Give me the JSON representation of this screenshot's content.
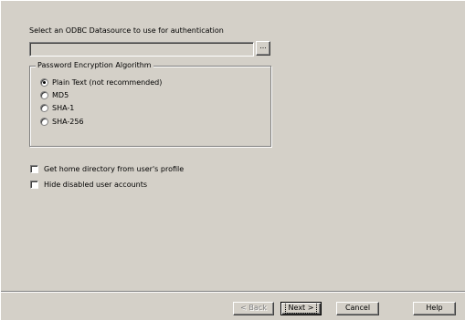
{
  "prompt": "Select an ODBC Datasource to use for authentication",
  "datasource": {
    "value": "",
    "browse_label": "..."
  },
  "encryption": {
    "title": "Password Encryption Algorithm",
    "options": [
      {
        "label": "Plain Text (not recommended)",
        "selected": true
      },
      {
        "label": "MD5",
        "selected": false
      },
      {
        "label": "SHA-1",
        "selected": false
      },
      {
        "label": "SHA-256",
        "selected": false
      }
    ]
  },
  "checkboxes": [
    {
      "label": "Get home directory from user's profile",
      "checked": false
    },
    {
      "label": "Hide disabled user accounts",
      "checked": false
    }
  ],
  "buttons": {
    "back": "< Back",
    "next": "Next >",
    "cancel": "Cancel",
    "help": "Help"
  }
}
